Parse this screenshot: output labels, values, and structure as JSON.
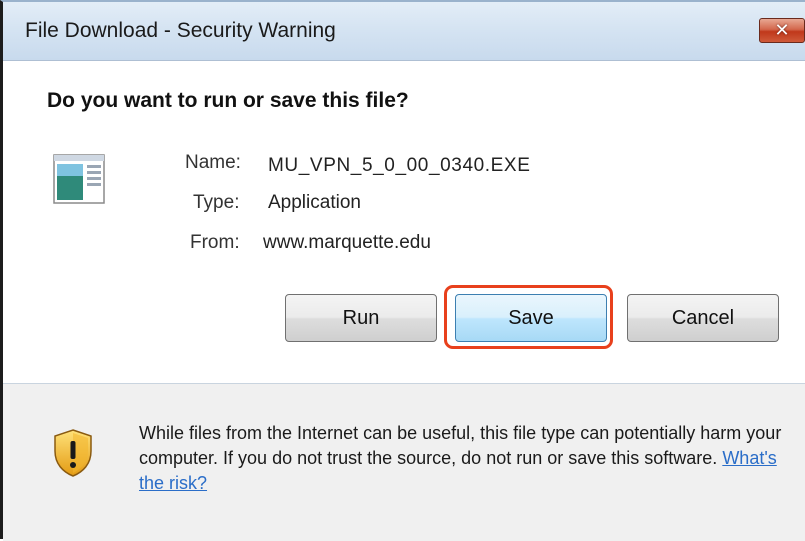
{
  "window": {
    "title": "File Download - Security Warning",
    "close_glyph": "✕"
  },
  "dialog": {
    "question": "Do you want to run or save this file?",
    "file_icon": "application-file-icon",
    "fields": {
      "name_label": "Name:",
      "name_value": "MU_VPN_5_0_00_0340.EXE",
      "type_label": "Type:",
      "type_value": "Application",
      "from_label": "From:",
      "from_value": "www.marquette.edu"
    },
    "buttons": {
      "run": "Run",
      "save": "Save",
      "cancel": "Cancel"
    }
  },
  "footer": {
    "icon": "warning-shield-icon",
    "warning_text": "While files from the Internet can be useful, this file type can potentially harm your computer. If you do not trust the source, do not run or save this software. ",
    "risk_link": "What's the risk?"
  },
  "colors": {
    "highlight": "#e8401c",
    "link": "#2a6dc8",
    "focused_button": "#bee6fd"
  }
}
